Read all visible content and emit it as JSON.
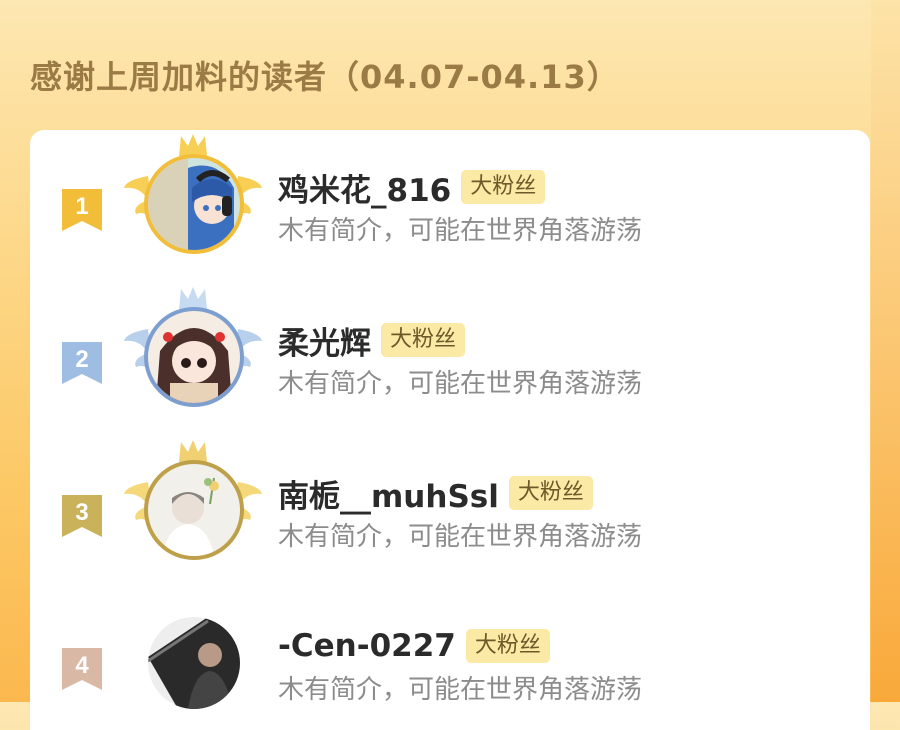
{
  "page": {
    "title": "感谢上周加料的读者（04.07-04.13）"
  },
  "colors": {
    "gold": "#f2be3a",
    "silver_blue": "#9fbde3",
    "bronze": "#c9b25a",
    "rank4": "#d9b9a6",
    "fan_badge_bg": "#fbeaa5"
  },
  "readers": [
    {
      "rank": "1",
      "name": "鸡米花_816",
      "badge": "大粉丝",
      "bio": "木有简介，可能在世界角落游荡",
      "frame": "gold-crown-wings"
    },
    {
      "rank": "2",
      "name": "柔光辉",
      "badge": "大粉丝",
      "bio": "木有简介，可能在世界角落游荡",
      "frame": "blue-crown-wings"
    },
    {
      "rank": "3",
      "name": "南栀__muhSsl",
      "badge": "大粉丝",
      "bio": "木有简介，可能在世界角落游荡",
      "frame": "bronze-crown-wings"
    },
    {
      "rank": "4",
      "name": "-Cen-0227",
      "badge": "大粉丝",
      "bio": "木有简介，可能在世界角落游荡",
      "frame": "none"
    }
  ]
}
